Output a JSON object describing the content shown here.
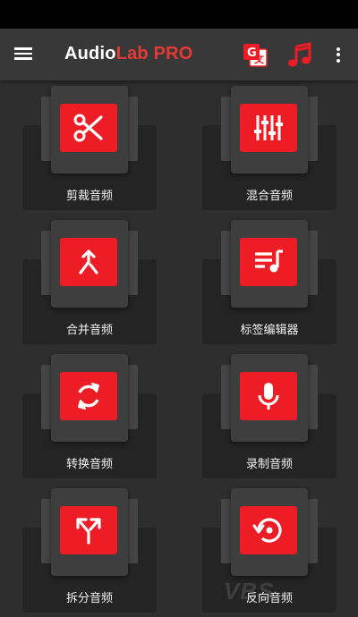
{
  "app": {
    "title_part1": "Audio",
    "title_part2": "Lab",
    "title_part3": " PRO"
  },
  "toolbar": {
    "icons": [
      "menu-icon",
      "translate-icon",
      "music-note-icon",
      "more-vert-icon"
    ]
  },
  "colors": {
    "accent": "#ee1c24",
    "app_bar": "#383838",
    "background": "#2e2e2e"
  },
  "tools": [
    {
      "label": "剪裁音频",
      "icon": "scissors-icon"
    },
    {
      "label": "混合音频",
      "icon": "equalizer-icon"
    },
    {
      "label": "合并音频",
      "icon": "merge-icon"
    },
    {
      "label": "标签编辑器",
      "icon": "playlist-music-icon"
    },
    {
      "label": "转换音频",
      "icon": "sync-icon"
    },
    {
      "label": "录制音频",
      "icon": "microphone-icon"
    },
    {
      "label": "拆分音频",
      "icon": "split-icon"
    },
    {
      "label": "反向音频",
      "icon": "reverse-icon"
    }
  ]
}
